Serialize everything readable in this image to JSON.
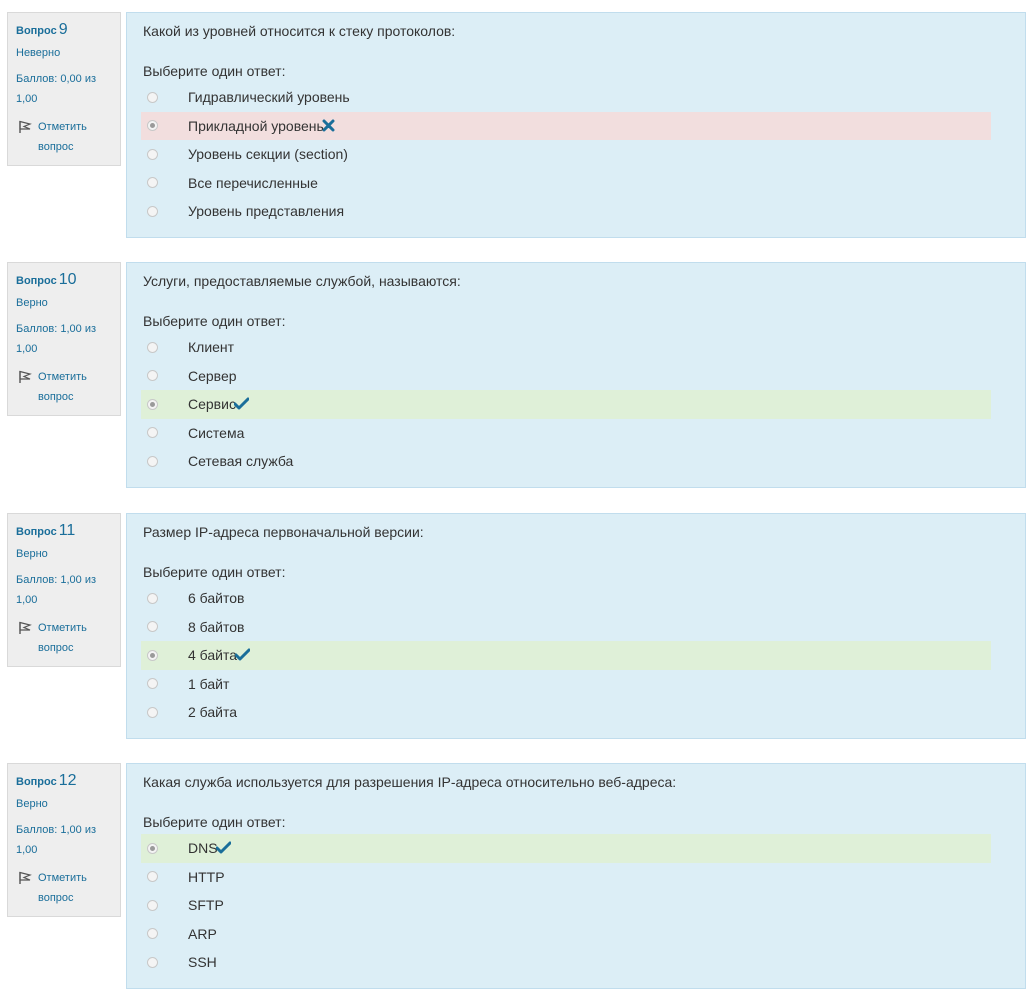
{
  "labels": {
    "question_word": "Вопрос",
    "flag_label": "Отметить вопрос",
    "choose_prompt": "Выберите один ответ:"
  },
  "questions": [
    {
      "number": "9",
      "state": "Неверно",
      "grade": "Баллов: 0,00 из 1,00",
      "text": "Какой из уровней относится к стеку протоколов:",
      "answers": [
        {
          "label": "Гидравлический уровень",
          "selected": false,
          "mark": null
        },
        {
          "label": "Прикладной уровень",
          "selected": true,
          "mark": "incorrect"
        },
        {
          "label": "Уровень секции (section)",
          "selected": false,
          "mark": null
        },
        {
          "label": "Все перечисленные",
          "selected": false,
          "mark": null
        },
        {
          "label": "Уровень представления",
          "selected": false,
          "mark": null
        }
      ]
    },
    {
      "number": "10",
      "state": "Верно",
      "grade": "Баллов: 1,00 из 1,00",
      "text": "Услуги, предоставляемые службой, называются:",
      "answers": [
        {
          "label": "Клиент",
          "selected": false,
          "mark": null
        },
        {
          "label": "Сервер",
          "selected": false,
          "mark": null
        },
        {
          "label": "Сервис",
          "selected": true,
          "mark": "correct"
        },
        {
          "label": "Система",
          "selected": false,
          "mark": null
        },
        {
          "label": "Сетевая служба",
          "selected": false,
          "mark": null
        }
      ]
    },
    {
      "number": "11",
      "state": "Верно",
      "grade": "Баллов: 1,00 из 1,00",
      "text": "Размер IP-адреса первоначальной версии:",
      "answers": [
        {
          "label": "6 байтов",
          "selected": false,
          "mark": null
        },
        {
          "label": "8 байтов",
          "selected": false,
          "mark": null
        },
        {
          "label": "4 байта",
          "selected": true,
          "mark": "correct"
        },
        {
          "label": "1 байт",
          "selected": false,
          "mark": null
        },
        {
          "label": "2 байта",
          "selected": false,
          "mark": null
        }
      ]
    },
    {
      "number": "12",
      "state": "Верно",
      "grade": "Баллов: 1,00 из 1,00",
      "text": "Какая служба используется для разрешения IP-адреса относительно веб-адреса:",
      "answers": [
        {
          "label": "DNS",
          "selected": true,
          "mark": "correct"
        },
        {
          "label": "HTTP",
          "selected": false,
          "mark": null
        },
        {
          "label": "SFTP",
          "selected": false,
          "mark": null
        },
        {
          "label": "ARP",
          "selected": false,
          "mark": null
        },
        {
          "label": "SSH",
          "selected": false,
          "mark": null
        }
      ]
    }
  ],
  "colors": {
    "info_bg": "#eeeeee",
    "content_bg": "#dceef6",
    "link": "#1a6e9a",
    "correct_bg": "#dff0d8",
    "incorrect_bg": "#f2dede",
    "mark_color": "#1a6e9a"
  },
  "icons": {
    "flag": "flag-icon",
    "correct": "checkmark-icon",
    "incorrect": "cross-icon"
  }
}
